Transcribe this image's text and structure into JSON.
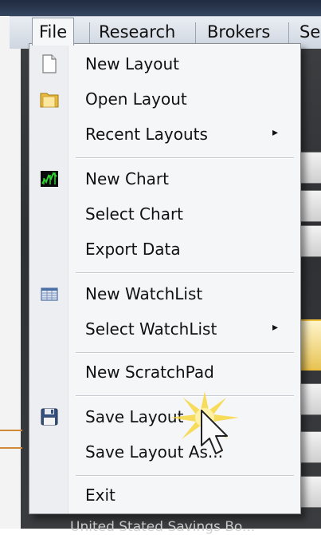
{
  "menubar": {
    "items": [
      "File",
      "Research",
      "Brokers",
      "Se"
    ]
  },
  "file_menu": {
    "items": [
      {
        "label": "New Layout",
        "icon": "new-document-icon"
      },
      {
        "label": "Open Layout",
        "icon": "folder-icon"
      },
      {
        "label": "Recent Layouts",
        "submenu": true
      },
      {
        "label": "New Chart",
        "icon": "chart-icon"
      },
      {
        "label": "Select Chart"
      },
      {
        "label": "Export Data"
      },
      {
        "label": "New WatchList",
        "icon": "watchlist-icon"
      },
      {
        "label": "Select WatchList",
        "submenu": true
      },
      {
        "label": "New ScratchPad"
      },
      {
        "label": "Save Layout",
        "icon": "floppy-disk-icon"
      },
      {
        "label": "Save Layout As..."
      },
      {
        "label": "Exit"
      }
    ],
    "submenu_arrow": "▸"
  },
  "background": {
    "bottom_text": "United Stated Savings Bo..."
  },
  "colors": {
    "menu_bg": "#f5f6f8",
    "highlight": "#f0c13a",
    "chart_icon_green": "#2fd12f"
  }
}
